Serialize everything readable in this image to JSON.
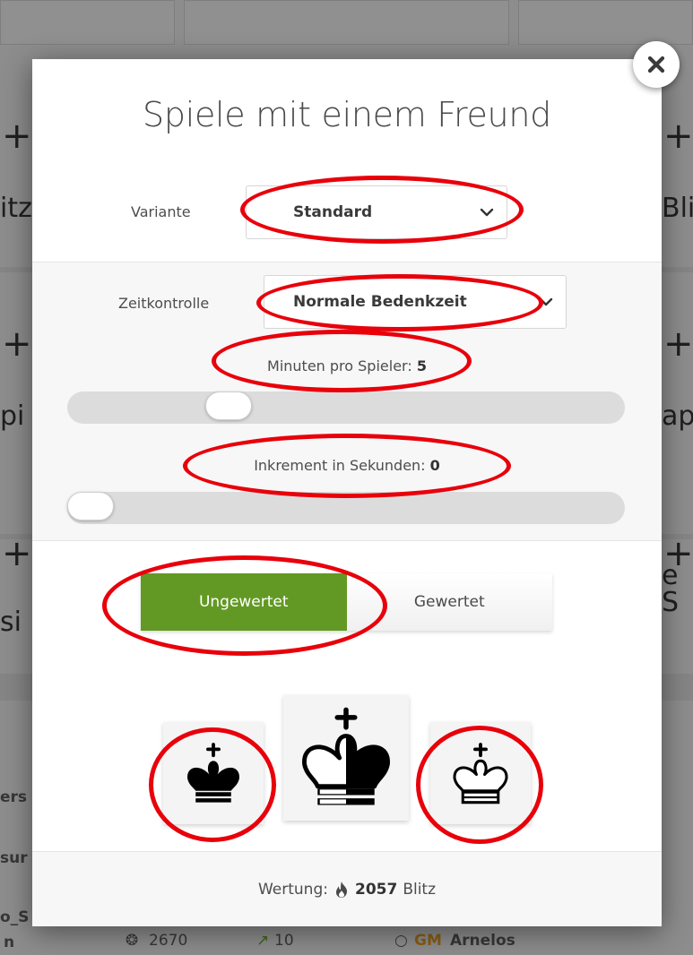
{
  "modal": {
    "title": "Spiele mit einem Freund",
    "variant": {
      "label": "Variante",
      "value": "Standard"
    },
    "time_control": {
      "label": "Zeitkontrolle",
      "value": "Normale Bedenkzeit"
    },
    "minutes": {
      "label": "Minuten pro Spieler:",
      "value": "5",
      "slider_fraction": 0.27
    },
    "increment": {
      "label": "Inkrement in Sekunden:",
      "value": "0",
      "slider_fraction": 0
    },
    "mode": {
      "unrated": "Ungewertet",
      "rated": "Gewertet",
      "selected": "Ungewertet"
    },
    "color_buttons": [
      "black-king-icon",
      "random-king-icon",
      "white-king-icon"
    ],
    "rating": {
      "label": "Wertung:",
      "value": "2057",
      "type": "Blitz"
    }
  },
  "background": {
    "fragments": [
      "+",
      "+",
      "+",
      "+",
      "+",
      "+",
      "itz",
      "Bli",
      "pi",
      "ap",
      "si",
      "e S",
      "ers",
      "sur",
      "o_S",
      "n"
    ],
    "player": {
      "rating": "2670",
      "trend": "10",
      "title": "GM",
      "name": "Arnelos"
    }
  },
  "colors": {
    "accent_green": "#629924",
    "annotation_red": "#e8000b"
  }
}
